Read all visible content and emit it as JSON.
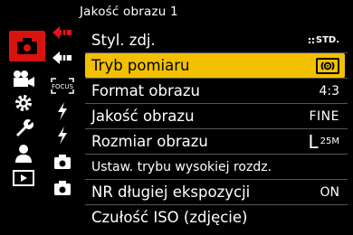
{
  "header": {
    "title": "Jakość obrazu 1"
  },
  "tabs": [
    {
      "icon": "camera-icon",
      "active": true
    },
    {
      "icon": "video-camera-icon"
    },
    {
      "icon": "gear-icon"
    },
    {
      "icon": "wrench-icon"
    },
    {
      "icon": "person-icon"
    },
    {
      "icon": "playback-icon"
    }
  ],
  "subtabs": [
    {
      "icon": "arrow-left-red-icon",
      "active": true
    },
    {
      "icon": "arrow-left-icon"
    },
    {
      "icon": "focus-icon",
      "label": "FOCUS"
    },
    {
      "icon": "flash-icon"
    },
    {
      "icon": "flash-icon"
    },
    {
      "icon": "camera-small-icon"
    },
    {
      "icon": "camera-small-icon"
    }
  ],
  "menu": {
    "items": [
      {
        "label": "Styl. zdj.",
        "value": "STD.",
        "value_icon": "photo-style-icon"
      },
      {
        "label": "Tryb pomiaru",
        "value": "",
        "value_icon": "metering-icon",
        "selected": true
      },
      {
        "label": "Format obrazu",
        "value": "4:3"
      },
      {
        "label": "Jakość obrazu",
        "value": "FINE"
      },
      {
        "label": "Rozmiar obrazu",
        "value": "L",
        "value_sub": "25M"
      },
      {
        "label": "Ustaw. trybu wysokiej rozdz.",
        "value": ""
      },
      {
        "label": "NR długiej ekspozycji",
        "value": "ON"
      },
      {
        "label": "Czułość ISO (zdjęcie)",
        "value": ""
      }
    ]
  },
  "colors": {
    "highlight": "#f3c000",
    "active_tab": "#d8130f",
    "accent_red": "#e4121a"
  }
}
